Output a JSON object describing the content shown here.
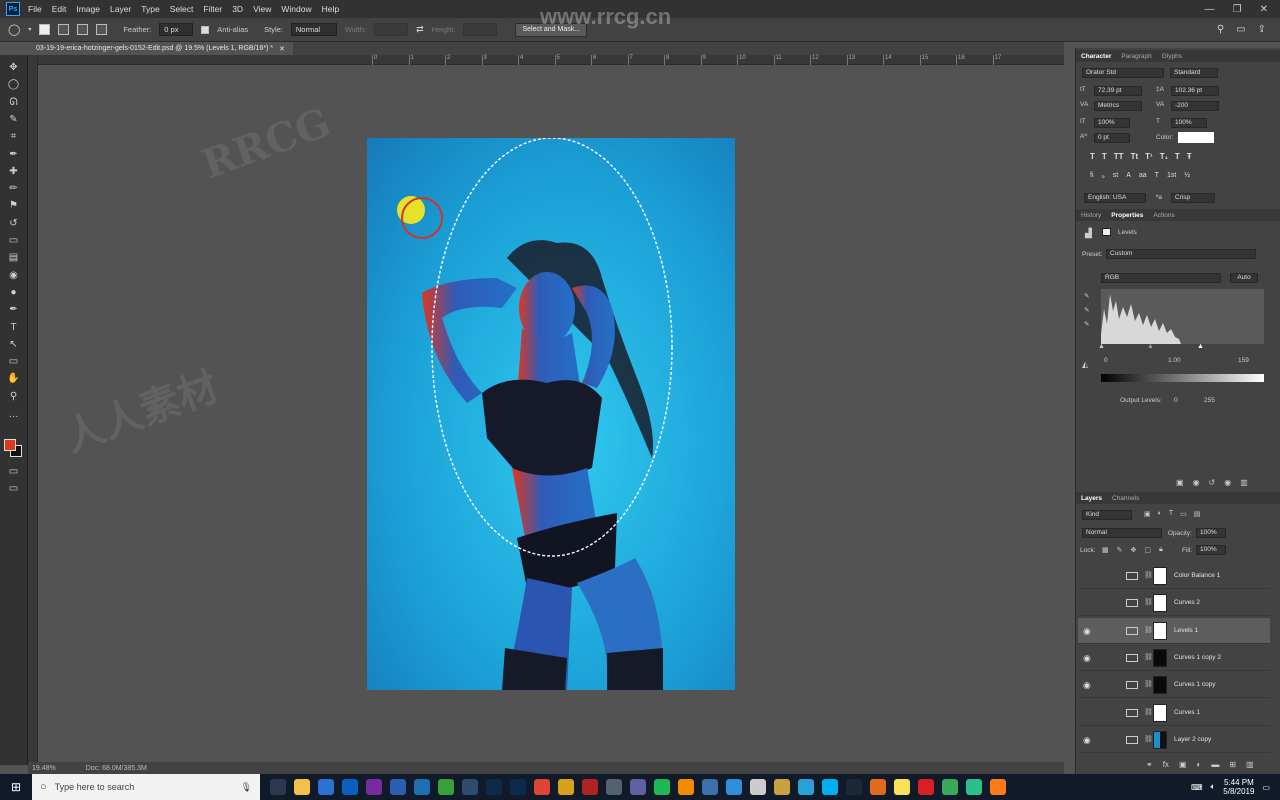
{
  "menu": [
    "File",
    "Edit",
    "Image",
    "Layer",
    "Type",
    "Select",
    "Filter",
    "3D",
    "View",
    "Window",
    "Help"
  ],
  "app_badge": "Ps",
  "options": {
    "feather_label": "Feather:",
    "feather_value": "0 px",
    "antialias_label": "Anti-alias",
    "style_label": "Style:",
    "style_value": "Normal",
    "width_label": "Width:",
    "height_label": "Height:",
    "select_mask": "Select and Mask..."
  },
  "watermark_site": "www.rrcg.cn",
  "watermark_brand": "RRCG",
  "watermark_cn": "人人素材",
  "document": {
    "tab_title": "03-19-19-erica-hotzinger-gels-0152-Edit.psd @ 19.5% (Levels 1, RGB/16*) *",
    "zoom": "19.48%",
    "doc_size": "Doc: 68.0M/385.3M"
  },
  "ruler_ticks": [
    "0",
    "1",
    "2",
    "3",
    "4",
    "5",
    "6",
    "7",
    "8",
    "9",
    "10",
    "11",
    "12",
    "13",
    "14",
    "15",
    "16",
    "17"
  ],
  "tools": [
    "move-tool",
    "marquee-tool",
    "lasso-tool",
    "quick-select-tool",
    "crop-tool",
    "eyedropper-tool",
    "healing-tool",
    "brush-tool",
    "stamp-tool",
    "history-brush-tool",
    "eraser-tool",
    "gradient-tool",
    "blur-tool",
    "dodge-tool",
    "pen-tool",
    "type-tool",
    "path-select-tool",
    "shape-tool",
    "hand-tool",
    "zoom-tool"
  ],
  "tool_glyphs": [
    "✥",
    "◯",
    "ᘏ",
    "✎",
    "⌗",
    "✒",
    "✚",
    "✏",
    "⚑",
    "↺",
    "▭",
    "▤",
    "◉",
    "●",
    "✒",
    "T",
    "↖",
    "▭",
    "✋",
    "⚲"
  ],
  "colors": {
    "foreground": "#d93a1e",
    "background": "#111111",
    "accent": "#31a8ff"
  },
  "character": {
    "tabs": [
      "Character",
      "Paragraph",
      "Glyphs"
    ],
    "font": "Orator Std",
    "style": "Standard",
    "size": "72.39 pt",
    "leading": "102.36 pt",
    "kerning": "Metrics",
    "tracking": "-200",
    "vscale": "100%",
    "hscale": "100%",
    "baseline": "0 pt",
    "color_label": "Color:",
    "language": "English: USA",
    "aa": "Crisp",
    "style_buttons": [
      "T",
      "T",
      "TT",
      "Tt",
      "T¹",
      "T₁",
      "T",
      "Ŧ"
    ],
    "ot_buttons": [
      "fi",
      "ℴ",
      "st",
      "A",
      "aa",
      "T",
      "1st",
      "½"
    ]
  },
  "properties": {
    "tabs": [
      "History",
      "Properties",
      "Actions"
    ],
    "title": "Levels",
    "preset_label": "Preset:",
    "preset_value": "Custom",
    "channel": "RGB",
    "auto": "Auto",
    "input": [
      "0",
      "1.00",
      "159"
    ],
    "output_label": "Output Levels:",
    "output": [
      "0",
      "255"
    ]
  },
  "layers_panel": {
    "tabs": [
      "Layers",
      "Channels"
    ],
    "kind": "Kind",
    "blend": "Normal",
    "opacity_label": "Opacity:",
    "opacity": "100%",
    "lock_label": "Lock:",
    "fill_label": "Fill:",
    "fill": "100%"
  },
  "layers": [
    {
      "name": "Color Balance 1",
      "visible": false,
      "selected": false,
      "mask": "white"
    },
    {
      "name": "Curves 2",
      "visible": false,
      "selected": false,
      "mask": "white"
    },
    {
      "name": "Levels 1",
      "visible": true,
      "selected": true,
      "mask": "white"
    },
    {
      "name": "Curves 1 copy 2",
      "visible": true,
      "selected": false,
      "mask": "black"
    },
    {
      "name": "Curves 1 copy",
      "visible": true,
      "selected": false,
      "mask": "black"
    },
    {
      "name": "Curves 1",
      "visible": false,
      "selected": false,
      "mask": "white"
    },
    {
      "name": "Layer 2 copy",
      "visible": true,
      "selected": false,
      "mask": "photo"
    }
  ],
  "taskbar": {
    "search_placeholder": "Type here to search",
    "time": "5:44 PM",
    "date": "5/8/2019"
  }
}
